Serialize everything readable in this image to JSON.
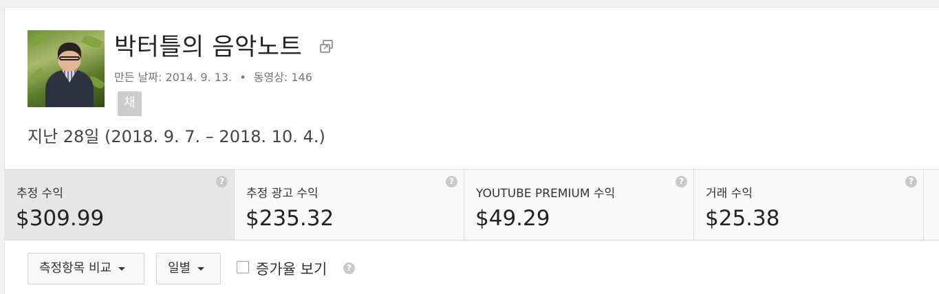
{
  "channel": {
    "name": "박터틀의 음악노트",
    "created_label": "만든 날짜:",
    "created_date": "2014. 9. 13.",
    "separator": "•",
    "videos_label": "동영상:",
    "videos_count": "146",
    "badge": "채널",
    "avatar_icon": "channel-avatar",
    "link_icon": "external-link-icon"
  },
  "date_range": "지난 28일 (2018. 9. 7. – 2018. 10. 4.)",
  "metrics": [
    {
      "label": "추정 수익",
      "value": "$309.99",
      "selected": true,
      "help": "?"
    },
    {
      "label": "추정 광고 수익",
      "value": "$235.32",
      "selected": false,
      "help": "?"
    },
    {
      "label": "YOUTUBE PREMIUM 수익",
      "value": "$49.29",
      "selected": false,
      "help": "?"
    },
    {
      "label": "거래 수익",
      "value": "$25.38",
      "selected": false,
      "help": "?"
    }
  ],
  "toolbar": {
    "compare_label": "측정항목 비교",
    "interval_label": "일별",
    "growth_label": "증가율 보기",
    "growth_checked": false,
    "help": "?"
  }
}
